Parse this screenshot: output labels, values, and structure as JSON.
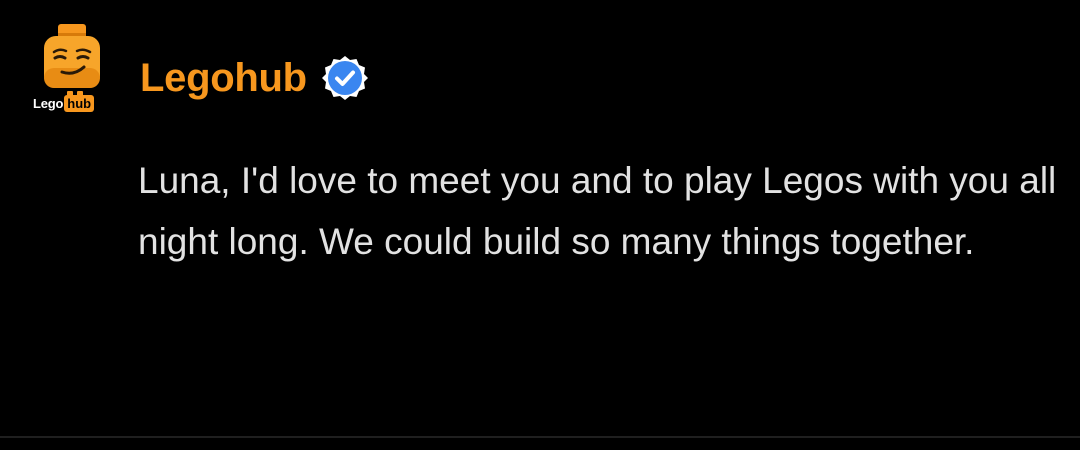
{
  "comment": {
    "author": {
      "name": "Legohub",
      "verified": true,
      "verified_icon": "verified-check-icon",
      "avatar": {
        "icon": "lego-minifig-head-icon",
        "wordmark_left": "Lego",
        "wordmark_right": "hub"
      }
    },
    "text": "Luna, I'd love to meet you and to play Legos with you all night long. We could build so many things together."
  },
  "colors": {
    "background": "#000000",
    "brand_orange": "#f7971e",
    "text": "#e2e2e2",
    "verified_blue": "#3a86f0",
    "divider": "#1f1f1f"
  }
}
